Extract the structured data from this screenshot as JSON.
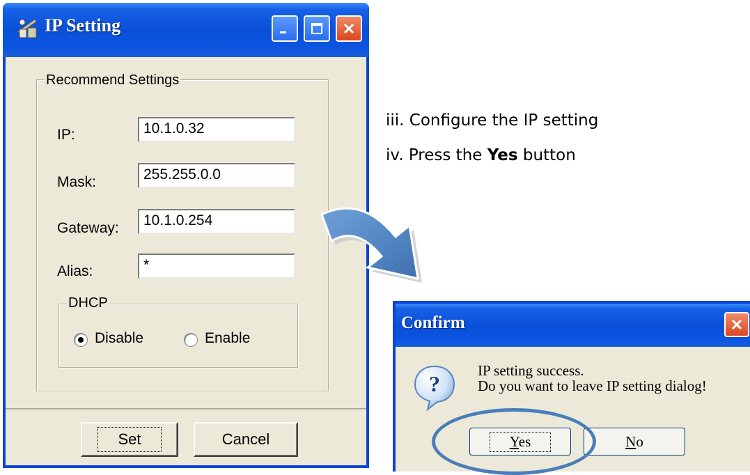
{
  "ip_window": {
    "title": "IP Setting",
    "group_label": "Recommend Settings",
    "fields": {
      "ip": {
        "label": "IP:",
        "value": "10.1.0.32"
      },
      "mask": {
        "label": "Mask:",
        "value": "255.255.0.0"
      },
      "gateway": {
        "label": "Gateway:",
        "value": "10.1.0.254"
      },
      "alias": {
        "label": "Alias:",
        "value": "*"
      }
    },
    "dhcp": {
      "label": "DHCP",
      "options": [
        "Disable",
        "Enable"
      ],
      "selected": "Disable"
    },
    "buttons": {
      "set": "Set",
      "cancel": "Cancel"
    }
  },
  "instructions": {
    "step3": "iii. Configure the IP setting",
    "step4_prefix": "iv. Press the ",
    "step4_bold": "Yes",
    "step4_suffix": " button"
  },
  "confirm_dialog": {
    "title": "Confirm",
    "message_line1": "IP setting success.",
    "message_line2": "Do you want to leave IP setting dialog!",
    "yes_first": "Y",
    "yes_rest": "es",
    "no_first": "N",
    "no_rest": "o"
  },
  "colors": {
    "titlebar": "#0a4fd8",
    "dialog_bg": "#ece9d8",
    "arrow": "#4a7ebb",
    "highlight": "#4a7ebb"
  },
  "icons": [
    "network-app-icon",
    "minimize-icon",
    "maximize-icon",
    "close-icon",
    "question-icon",
    "curved-arrow-icon"
  ]
}
